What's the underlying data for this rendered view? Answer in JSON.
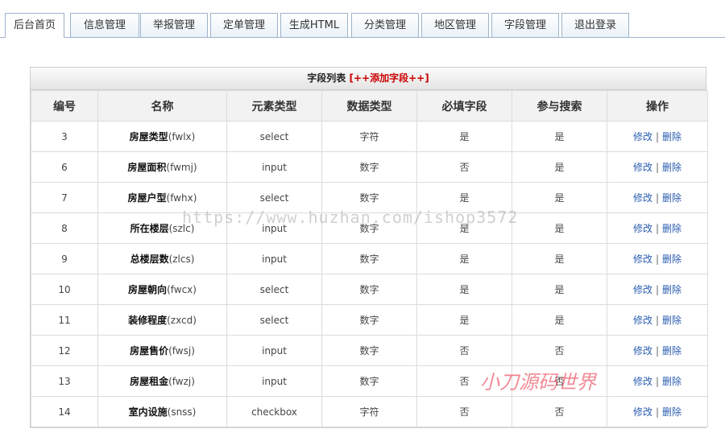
{
  "tabs": [
    {
      "label": "后台首页",
      "active": true
    },
    {
      "label": "信息管理",
      "active": false
    },
    {
      "label": "举报管理",
      "active": false
    },
    {
      "label": "定单管理",
      "active": false
    },
    {
      "label": "生成HTML",
      "active": false
    },
    {
      "label": "分类管理",
      "active": false
    },
    {
      "label": "地区管理",
      "active": false
    },
    {
      "label": "字段管理",
      "active": false
    },
    {
      "label": "退出登录",
      "active": false
    }
  ],
  "panel": {
    "title": "字段列表",
    "add_link": "[++添加字段++]"
  },
  "table": {
    "headers": [
      "编号",
      "名称",
      "元素类型",
      "数据类型",
      "必填字段",
      "参与搜索",
      "操作"
    ],
    "edit_label": "修改",
    "separator": "|",
    "delete_label": "删除",
    "rows": [
      {
        "id": "3",
        "name": "房屋类型",
        "code": "(fwlx)",
        "element": "select",
        "dtype": "字符",
        "required": "是",
        "search": "是"
      },
      {
        "id": "6",
        "name": "房屋面积",
        "code": "(fwmj)",
        "element": "input",
        "dtype": "数字",
        "required": "否",
        "search": "是"
      },
      {
        "id": "7",
        "name": "房屋户型",
        "code": "(fwhx)",
        "element": "select",
        "dtype": "数字",
        "required": "是",
        "search": "是"
      },
      {
        "id": "8",
        "name": "所在楼层",
        "code": "(szlc)",
        "element": "input",
        "dtype": "数字",
        "required": "是",
        "search": "是"
      },
      {
        "id": "9",
        "name": "总楼层数",
        "code": "(zlcs)",
        "element": "input",
        "dtype": "数字",
        "required": "是",
        "search": "是"
      },
      {
        "id": "10",
        "name": "房屋朝向",
        "code": "(fwcx)",
        "element": "select",
        "dtype": "数字",
        "required": "是",
        "search": "是"
      },
      {
        "id": "11",
        "name": "装修程度",
        "code": "(zxcd)",
        "element": "select",
        "dtype": "数字",
        "required": "是",
        "search": "是"
      },
      {
        "id": "12",
        "name": "房屋售价",
        "code": "(fwsj)",
        "element": "input",
        "dtype": "数字",
        "required": "否",
        "search": "否"
      },
      {
        "id": "13",
        "name": "房屋租金",
        "code": "(fwzj)",
        "element": "input",
        "dtype": "数字",
        "required": "否",
        "search": "否"
      },
      {
        "id": "14",
        "name": "室内设施",
        "code": "(snss)",
        "element": "checkbox",
        "dtype": "字符",
        "required": "否",
        "search": "否"
      }
    ]
  },
  "watermarks": {
    "url": "https://www.huzhan.com/ishop3572",
    "brand": "小刀源码世界"
  }
}
